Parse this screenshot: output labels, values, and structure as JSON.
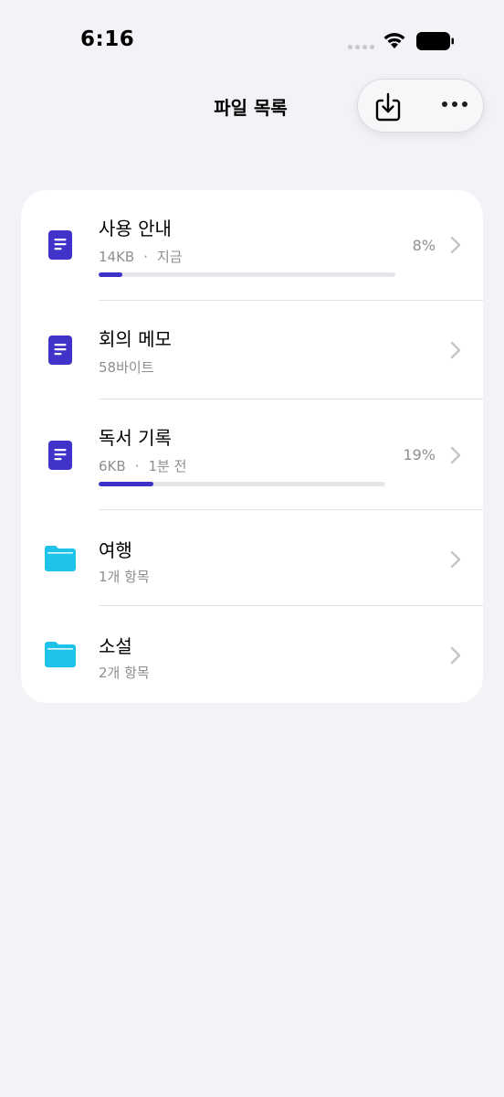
{
  "status_bar": {
    "time": "6:16",
    "icons": [
      "signal-dots-icon",
      "wifi-icon",
      "battery-icon"
    ]
  },
  "nav": {
    "title": "파일 목록",
    "actions": [
      "download-icon",
      "more-icon"
    ]
  },
  "colors": {
    "accent": "#3c32c8",
    "document_icon": "#3f33c9",
    "folder_icon": "#1ec3ea",
    "background": "#f2f2f7",
    "secondary_text": "#8e8e93"
  },
  "files": [
    {
      "title": "사용 안내",
      "size": "14KB",
      "separator": "·",
      "time": "지금",
      "percent": "8%",
      "progress": 0.08,
      "icon": "document-icon"
    },
    {
      "title": "회의 메모",
      "size": "58바이트",
      "icon": "document-icon"
    },
    {
      "title": "독서 기록",
      "size": "6KB",
      "separator": "·",
      "time": "1분 전",
      "percent": "19%",
      "progress": 0.19,
      "icon": "document-icon"
    },
    {
      "title": "여행",
      "size": "1개 항목",
      "icon": "folder-icon"
    },
    {
      "title": "소설",
      "size": "2개 항목",
      "icon": "folder-icon"
    }
  ]
}
